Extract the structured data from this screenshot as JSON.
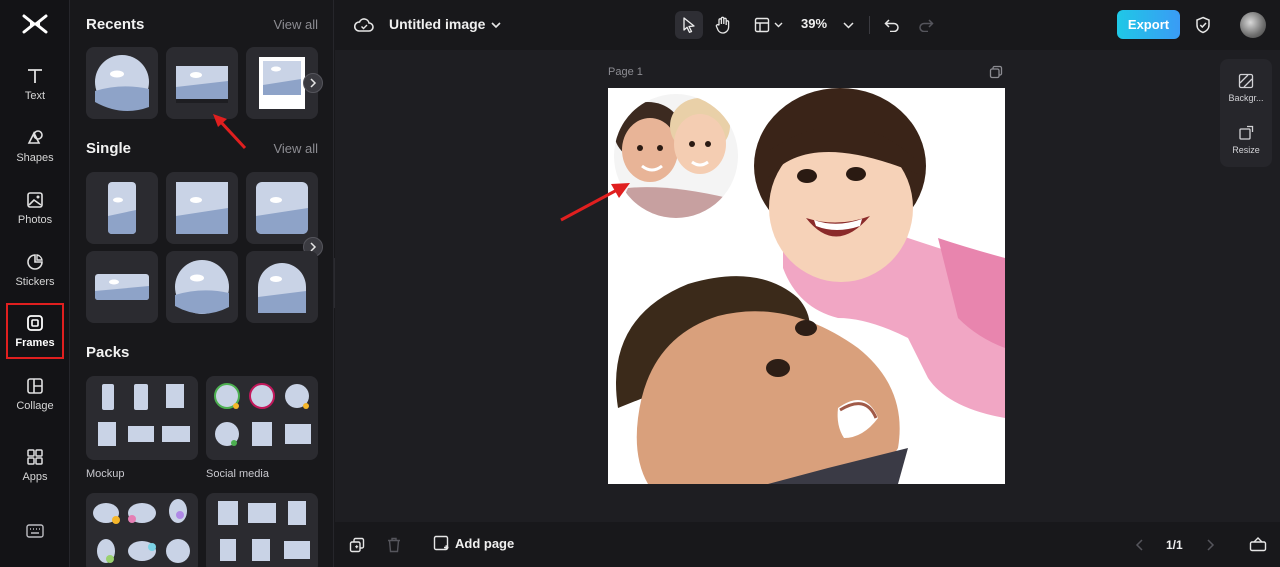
{
  "rail": {
    "items": [
      {
        "label": "Text",
        "icon": "text-icon"
      },
      {
        "label": "Shapes",
        "icon": "shapes-icon"
      },
      {
        "label": "Photos",
        "icon": "photos-icon"
      },
      {
        "label": "Stickers",
        "icon": "stickers-icon"
      },
      {
        "label": "Frames",
        "icon": "frames-icon",
        "active": true
      },
      {
        "label": "Collage",
        "icon": "collage-icon"
      },
      {
        "label": "Apps",
        "icon": "apps-icon"
      }
    ],
    "highlight_color": "#e01f1f"
  },
  "panel": {
    "recents_title": "Recents",
    "single_title": "Single",
    "packs_title": "Packs",
    "view_all": "View all",
    "packs": [
      {
        "label": "Mockup"
      },
      {
        "label": "Social media"
      }
    ]
  },
  "topbar": {
    "title": "Untitled image",
    "zoom": "39%",
    "export_label": "Export"
  },
  "canvas": {
    "page_label": "Page 1"
  },
  "side_tools": {
    "background_label": "Backgr...",
    "resize_label": "Resize"
  },
  "bottombar": {
    "add_page_label": "Add page",
    "page_count": "1/1"
  },
  "colors": {
    "accent": "#2aa8f0",
    "annotation_arrow": "#e01f1f",
    "panel_bg": "#18181b",
    "canvas_bg": "#1e1e22"
  }
}
